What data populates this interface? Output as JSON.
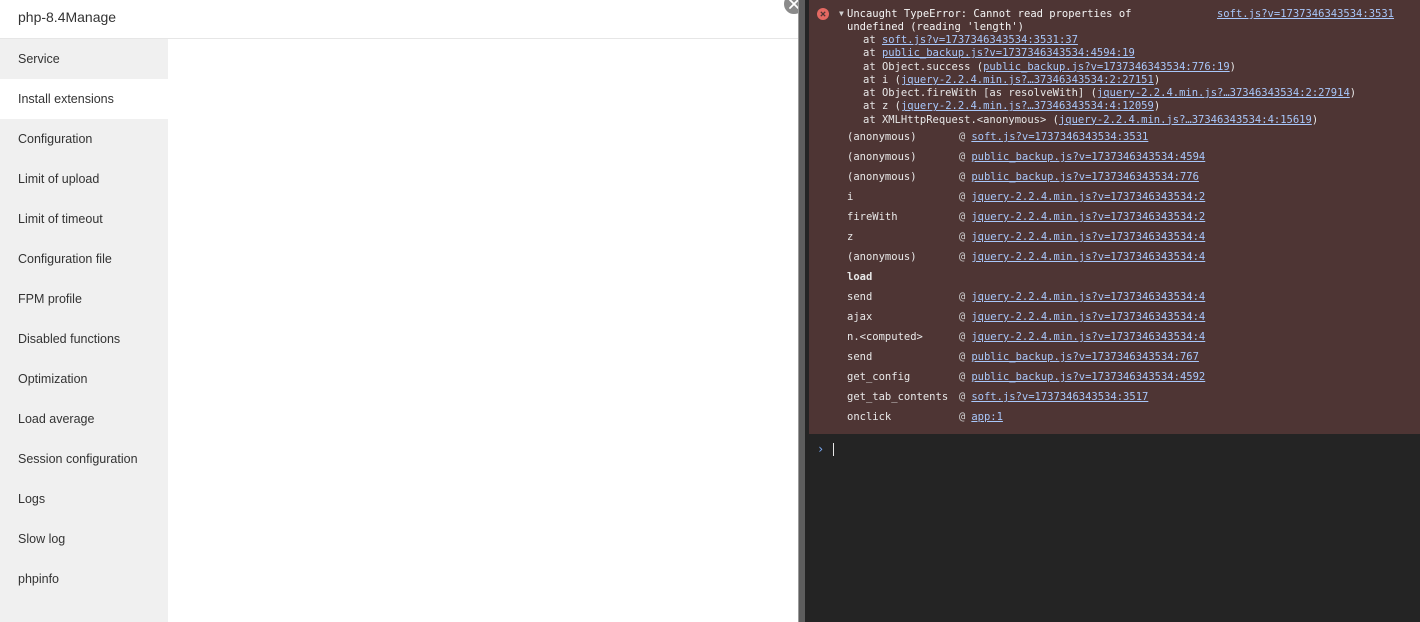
{
  "panel": {
    "title": "php-8.4Manage",
    "sidebar": [
      {
        "label": "Service",
        "active": false
      },
      {
        "label": "Install extensions",
        "active": true
      },
      {
        "label": "Configuration",
        "active": false
      },
      {
        "label": "Limit of upload",
        "active": false
      },
      {
        "label": "Limit of timeout",
        "active": false
      },
      {
        "label": "Configuration file",
        "active": false
      },
      {
        "label": "FPM profile",
        "active": false
      },
      {
        "label": "Disabled functions",
        "active": false
      },
      {
        "label": "Optimization",
        "active": false
      },
      {
        "label": "Load average",
        "active": false
      },
      {
        "label": "Session configuration",
        "active": false
      },
      {
        "label": "Logs",
        "active": false
      },
      {
        "label": "Slow log",
        "active": false
      },
      {
        "label": "phpinfo",
        "active": false
      }
    ],
    "close_icon": "close-icon"
  },
  "console": {
    "error": {
      "message": "Uncaught TypeError: Cannot read properties of\nundefined (reading 'length')",
      "source": "soft.js?v=1737346343534:3531",
      "stack": [
        {
          "prefix": "at ",
          "link": "soft.js?v=1737346343534:3531:37",
          "suffix": ""
        },
        {
          "prefix": "at ",
          "link": "public_backup.js?v=1737346343534:4594:19",
          "suffix": ""
        },
        {
          "prefix": "at Object.success (",
          "link": "public_backup.js?v=1737346343534:776:19",
          "suffix": ")"
        },
        {
          "prefix": "at i (",
          "link": "jquery-2.2.4.min.js?…37346343534:2:27151",
          "suffix": ")"
        },
        {
          "prefix": "at Object.fireWith [as resolveWith] (",
          "link": "jquery-2.2.4.min.js?…37346343534:2:27914",
          "suffix": ")"
        },
        {
          "prefix": "at z (",
          "link": "jquery-2.2.4.min.js?…37346343534:4:12059",
          "suffix": ")"
        },
        {
          "prefix": "at XMLHttpRequest.<anonymous> (",
          "link": "jquery-2.2.4.min.js?…37346343534:4:15619",
          "suffix": ")"
        }
      ]
    },
    "trace": [
      {
        "fn": "(anonymous)",
        "at": "@",
        "link": "soft.js?v=1737346343534:3531"
      },
      {
        "fn": "(anonymous)",
        "at": "@",
        "link": "public_backup.js?v=1737346343534:4594"
      },
      {
        "fn": "(anonymous)",
        "at": "@",
        "link": "public_backup.js?v=1737346343534:776"
      },
      {
        "fn": "i",
        "at": "@",
        "link": "jquery-2.2.4.min.js?v=1737346343534:2"
      },
      {
        "fn": "fireWith",
        "at": "@",
        "link": "jquery-2.2.4.min.js?v=1737346343534:2"
      },
      {
        "fn": "z",
        "at": "@",
        "link": "jquery-2.2.4.min.js?v=1737346343534:4"
      },
      {
        "fn": "(anonymous)",
        "at": "@",
        "link": "jquery-2.2.4.min.js?v=1737346343534:4"
      },
      {
        "fn": "load",
        "at": "",
        "link": "",
        "bold": true
      },
      {
        "fn": "send",
        "at": "@",
        "link": "jquery-2.2.4.min.js?v=1737346343534:4"
      },
      {
        "fn": "ajax",
        "at": "@",
        "link": "jquery-2.2.4.min.js?v=1737346343534:4"
      },
      {
        "fn": "n.<computed>",
        "at": "@",
        "link": "jquery-2.2.4.min.js?v=1737346343534:4"
      },
      {
        "fn": "send",
        "at": "@",
        "link": "public_backup.js?v=1737346343534:767"
      },
      {
        "fn": "get_config",
        "at": "@",
        "link": "public_backup.js?v=1737346343534:4592"
      },
      {
        "fn": "get_tab_contents",
        "at": "@",
        "link": "soft.js?v=1737346343534:3517"
      },
      {
        "fn": "onclick",
        "at": "@",
        "link": "app:1"
      }
    ],
    "prompt_chevron": "›",
    "prompt_value": ""
  },
  "colors": {
    "error_bg": "#4e3534",
    "console_bg": "#242424",
    "link": "#a8c7fa",
    "sidebar_bg": "#f0f0f0"
  }
}
